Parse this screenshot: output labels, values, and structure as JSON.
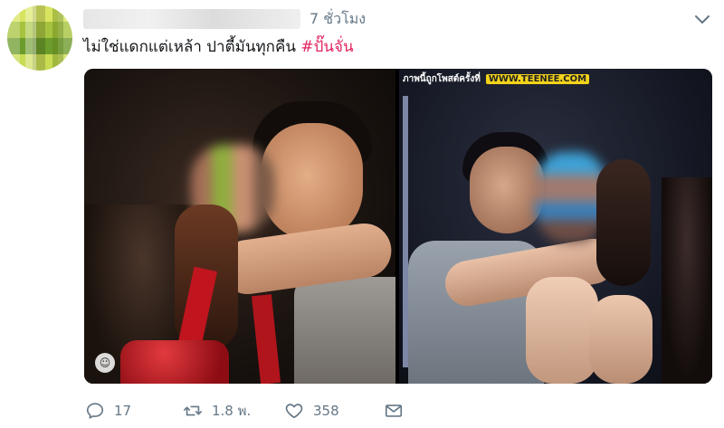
{
  "tweet": {
    "timestamp": "7 ชั่วโมง",
    "text": "ไม่ใช่แดกแต่เหล้า ปาตี้มันทุกคืน ",
    "hashtag": "#ปั๊นจั่น",
    "media": {
      "watermark_text": "ภาพนี้ถูกโพสต์ครั้งที่",
      "watermark_site": "WWW.TEENEE.COM",
      "badge_icon": "smiley-icon"
    }
  },
  "actions": {
    "reply_count": "17",
    "retweet_count": "1.8 พ.",
    "like_count": "358",
    "icons": {
      "reply": "comment-icon",
      "retweet": "retweet-icon",
      "like": "heart-icon",
      "dm": "envelope-icon",
      "more": "chevron-down-icon"
    }
  },
  "colors": {
    "hashtag": "#e0245e",
    "muted": "#657786",
    "text": "#14171a"
  }
}
